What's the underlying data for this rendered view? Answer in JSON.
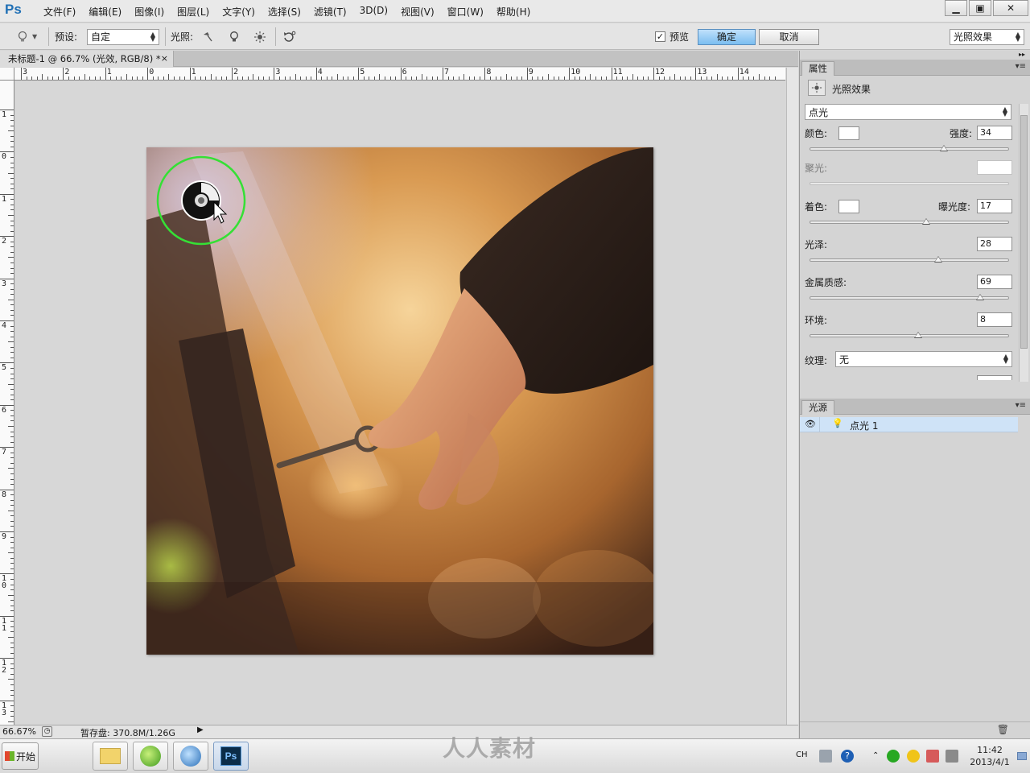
{
  "app": {
    "logo": "Ps"
  },
  "menu": [
    "文件(F)",
    "编辑(E)",
    "图像(I)",
    "图层(L)",
    "文字(Y)",
    "选择(S)",
    "滤镜(T)",
    "3D(D)",
    "视图(V)",
    "窗口(W)",
    "帮助(H)"
  ],
  "window_controls": {
    "minimize": "▁",
    "restore": "▣",
    "close": "✕"
  },
  "options": {
    "preset_label": "预设:",
    "preset_value": "自定",
    "lights_label": "光照:",
    "preview_label": "预览",
    "preview_checked": true,
    "ok_label": "确定",
    "cancel_label": "取消",
    "workspace_value": "光照效果"
  },
  "document": {
    "tab_title": "未标题-1 @ 66.7% (光效, RGB/8) *",
    "close": "×"
  },
  "rulers": {
    "h_labels": [
      "3",
      "2",
      "1",
      "0",
      "1",
      "2",
      "3",
      "4",
      "5",
      "6",
      "7",
      "8",
      "9",
      "10",
      "11",
      "12",
      "13",
      "14"
    ],
    "v_labels": [
      "1",
      "0",
      "1",
      "2",
      "3",
      "4",
      "5",
      "6",
      "7",
      "8",
      "9",
      "10",
      "11",
      "12",
      "13"
    ]
  },
  "status": {
    "zoom": "66.67%",
    "scratch": "暂存盘: 370.8M/1.26G"
  },
  "properties": {
    "tab": "属性",
    "header": "光照效果",
    "light_type": "点光",
    "color_label": "颜色:",
    "intensity_label": "强度:",
    "intensity": "34",
    "intensity_frac": 0.67,
    "hotspot_label": "聚光:",
    "colorize_label": "着色:",
    "exposure_label": "曝光度:",
    "exposure": "17",
    "exposure_frac": 0.58,
    "gloss_label": "光泽:",
    "gloss": "28",
    "gloss_frac": 0.64,
    "metallic_label": "金属质感:",
    "metallic": "69",
    "metallic_frac": 0.85,
    "ambience_label": "环境:",
    "ambience": "8",
    "ambience_frac": 0.54,
    "texture_label": "纹理:",
    "texture_value": "无"
  },
  "lights_panel": {
    "tab": "光源",
    "items": [
      {
        "name": "点光 1"
      }
    ]
  },
  "taskbar": {
    "start_label": "开始",
    "lang": "CH",
    "time": "11:42",
    "date": "2013/4/1"
  },
  "watermark": "人人素材",
  "colors": {
    "accent": "#3a7fd0",
    "selection": "#cfe3f7",
    "light_ring": "#3bd63b"
  }
}
